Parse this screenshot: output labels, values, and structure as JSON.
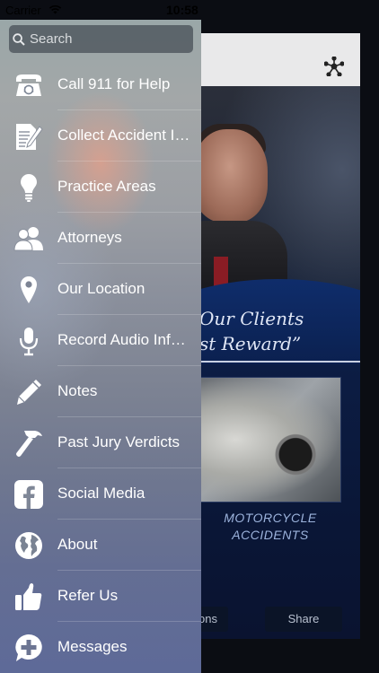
{
  "status_bar": {
    "carrier": "Carrier",
    "time": "10:58"
  },
  "search": {
    "placeholder": "Search"
  },
  "menu": {
    "items": [
      {
        "label": "Call 911 for Help",
        "icon": "telephone-icon"
      },
      {
        "label": "Collect Accident Information",
        "icon": "document-pen-icon"
      },
      {
        "label": "Practice Areas",
        "icon": "lightbulb-icon"
      },
      {
        "label": "Attorneys",
        "icon": "people-icon"
      },
      {
        "label": "Our Location",
        "icon": "map-pin-icon"
      },
      {
        "label": "Record Audio Information",
        "icon": "microphone-icon"
      },
      {
        "label": "Notes",
        "icon": "pencil-icon"
      },
      {
        "label": "Past Jury Verdicts",
        "icon": "hammer-icon"
      },
      {
        "label": "Social Media",
        "icon": "facebook-icon"
      },
      {
        "label": "About",
        "icon": "globe-icon"
      },
      {
        "label": "Refer Us",
        "icon": "thumbs-up-icon"
      },
      {
        "label": "Messages",
        "icon": "message-plus-icon"
      }
    ]
  },
  "background": {
    "tagline_line1": "Our Clients",
    "tagline_line2": "st Reward”",
    "caption_line1": "MOTORCYCLE",
    "caption_line2": "ACCIDENTS",
    "button_left": "ons",
    "button_right": "Share"
  },
  "colors": {
    "drawer_top": "#9aa7a8",
    "drawer_bottom": "#5e6a98",
    "background_navy": "#0c1d44"
  }
}
